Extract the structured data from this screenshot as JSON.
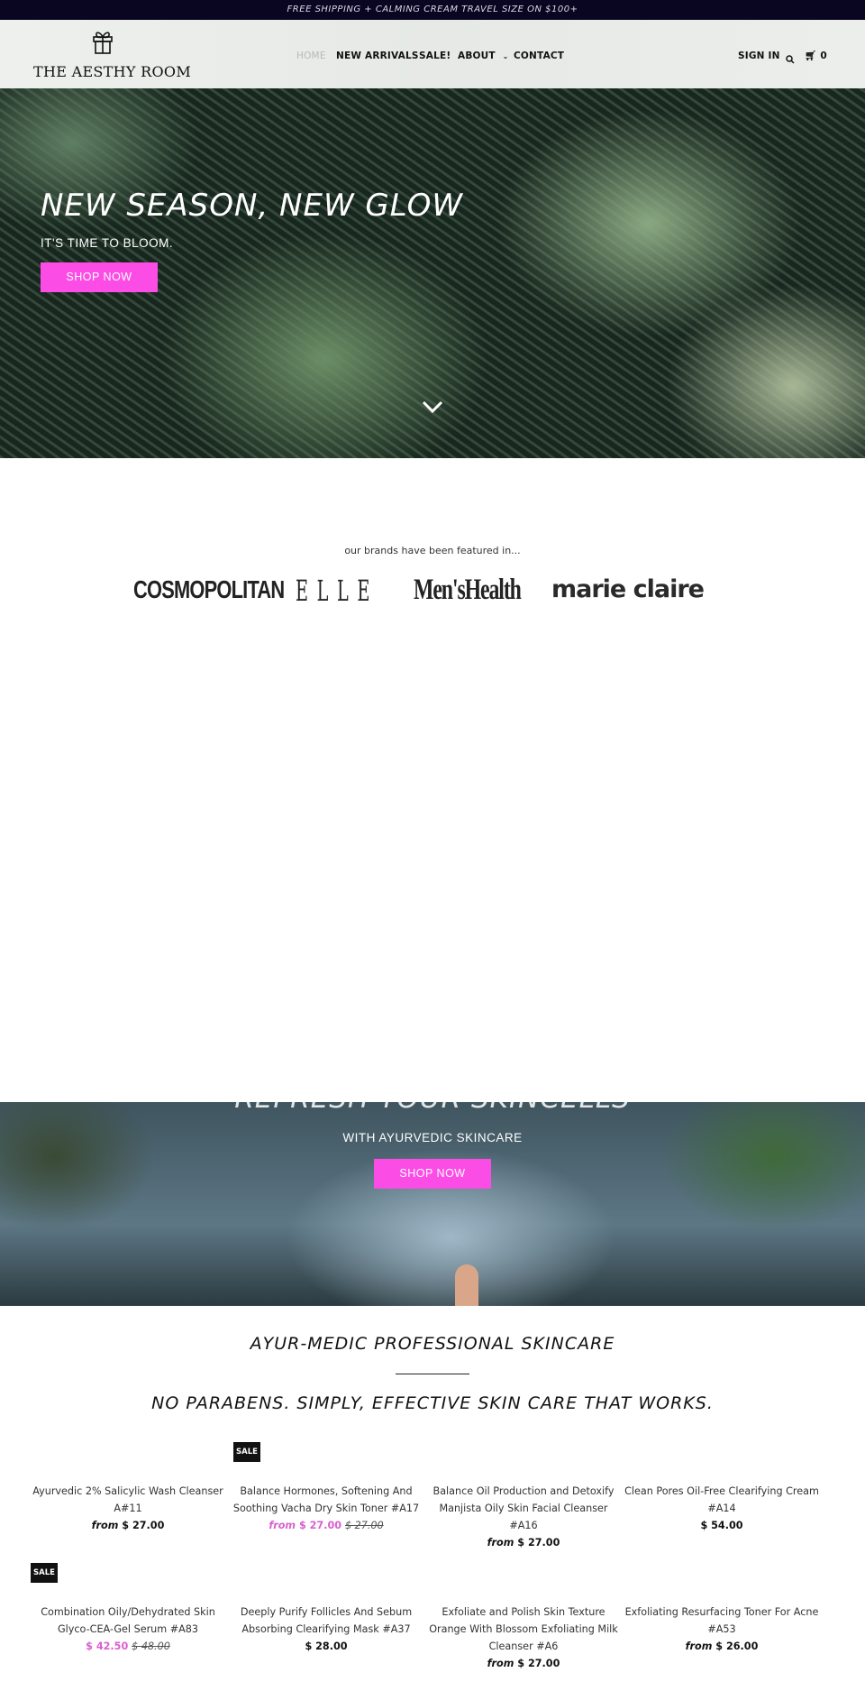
{
  "announcement": "FREE SHIPPING + CALMING CREAM TRAVEL SIZE ON $100+",
  "brand": {
    "name": "THE AESTHY ROOM",
    "icon": "gift-icon"
  },
  "nav": {
    "items": [
      "HOME",
      "NEW ARRIVALS",
      "SALE!",
      "ABOUT",
      "CONTACT"
    ],
    "active": "HOME",
    "sign_in": "SIGN IN",
    "cart_count": "0"
  },
  "hero": {
    "title": "NEW SEASON, NEW GLOW",
    "subtitle": "IT'S TIME TO BLOOM.",
    "button": "SHOP NOW"
  },
  "featured": {
    "label": "our brands have been featured in...",
    "logos": [
      "COSMOPOLITAN",
      "ELLE",
      "Men'sHealth",
      "marie claire"
    ]
  },
  "banner2": {
    "title": "REFRESH YOUR SKINCELLS",
    "subtitle": "WITH AYURVEDIC SKINCARE",
    "button": "SHOP NOW"
  },
  "collection": {
    "heading": "AYUR-MEDIC PROFESSIONAL SKINCARE",
    "subheading": "NO PARABENS. SIMPLY, EFFECTIVE SKIN CARE THAT WORKS."
  },
  "colors": {
    "accent": "#fb4de6",
    "sale_price": "#d95fcf",
    "topbar": "#0a0520"
  },
  "sale_badge": "SALE",
  "from_label": "from",
  "products": [
    {
      "name": "Ayurvedic 2% Salicylic Wash Cleanser A#11",
      "price": "$ 27.00",
      "from": true,
      "sale": false
    },
    {
      "name": "Balance Hormones, Softening And Soothing Vacha Dry Skin Toner #A17",
      "price": "$ 27.00",
      "old_price": "$ 27.00",
      "from": true,
      "sale": true
    },
    {
      "name": "Balance Oil Production and Detoxify Manjista Oily Skin Facial Cleanser #A16",
      "price": "$ 27.00",
      "from": true,
      "sale": false
    },
    {
      "name": "Clean Pores Oil-Free Clearifying Cream #A14",
      "price": "$ 54.00",
      "from": false,
      "sale": false
    },
    {
      "name": "Combination Oily/Dehydrated Skin Glyco-CEA-Gel Serum #A83",
      "price": "$ 42.50",
      "old_price": "$ 48.00",
      "from": false,
      "sale": true
    },
    {
      "name": "Deeply Purify Follicles And Sebum Absorbing Clearifying Mask #A37",
      "price": "$ 28.00",
      "from": false,
      "sale": false
    },
    {
      "name": "Exfoliate and Polish Skin Texture Orange With Blossom Exfoliating Milk Cleanser #A6",
      "price": "$ 27.00",
      "from": true,
      "sale": false
    },
    {
      "name": "Exfoliating Resurfacing Toner For Acne #A53",
      "price": "$ 26.00",
      "from": true,
      "sale": false
    }
  ]
}
